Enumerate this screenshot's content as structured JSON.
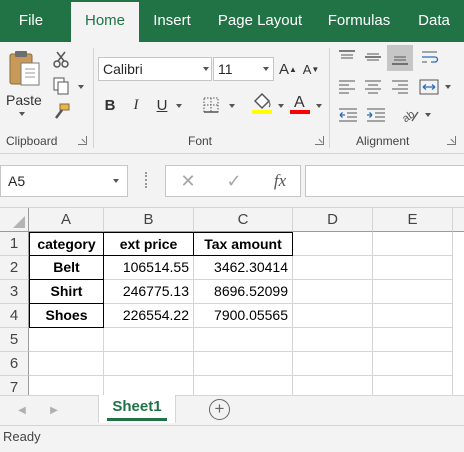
{
  "ribbon_tabs": [
    "File",
    "Home",
    "Insert",
    "Page Layout",
    "Formulas",
    "Data"
  ],
  "active_tab": "Home",
  "clipboard": {
    "paste_label": "Paste",
    "group_label": "Clipboard"
  },
  "font": {
    "name": "Calibri",
    "size": "11",
    "bold_label": "B",
    "italic_label": "I",
    "underline_label": "U",
    "group_label": "Font",
    "grow_label": "A",
    "shrink_label": "A",
    "fill_color": "#ffff00",
    "font_color": "#ff0000"
  },
  "alignment": {
    "group_label": "Alignment"
  },
  "formula_bar": {
    "name_box": "A5",
    "cancel_icon": "✕",
    "enter_icon": "✓",
    "fx_label": "fx",
    "formula": ""
  },
  "grid": {
    "columns": [
      "A",
      "B",
      "C",
      "D",
      "E"
    ],
    "row_numbers": [
      "1",
      "2",
      "3",
      "4",
      "5",
      "6",
      "7"
    ],
    "rows": [
      [
        "category",
        "ext price",
        "Tax amount"
      ],
      [
        "Belt",
        "106514.55",
        "3462.30414"
      ],
      [
        "Shirt",
        "246775.13",
        "8696.52099"
      ],
      [
        "Shoes",
        "226554.22",
        "7900.05565"
      ]
    ]
  },
  "sheets": {
    "active": "Sheet1",
    "add_label": "+"
  },
  "status": {
    "text": "Ready"
  },
  "colors": {
    "accent": "#217346",
    "ribbon_bg": "#f3f3f3"
  }
}
